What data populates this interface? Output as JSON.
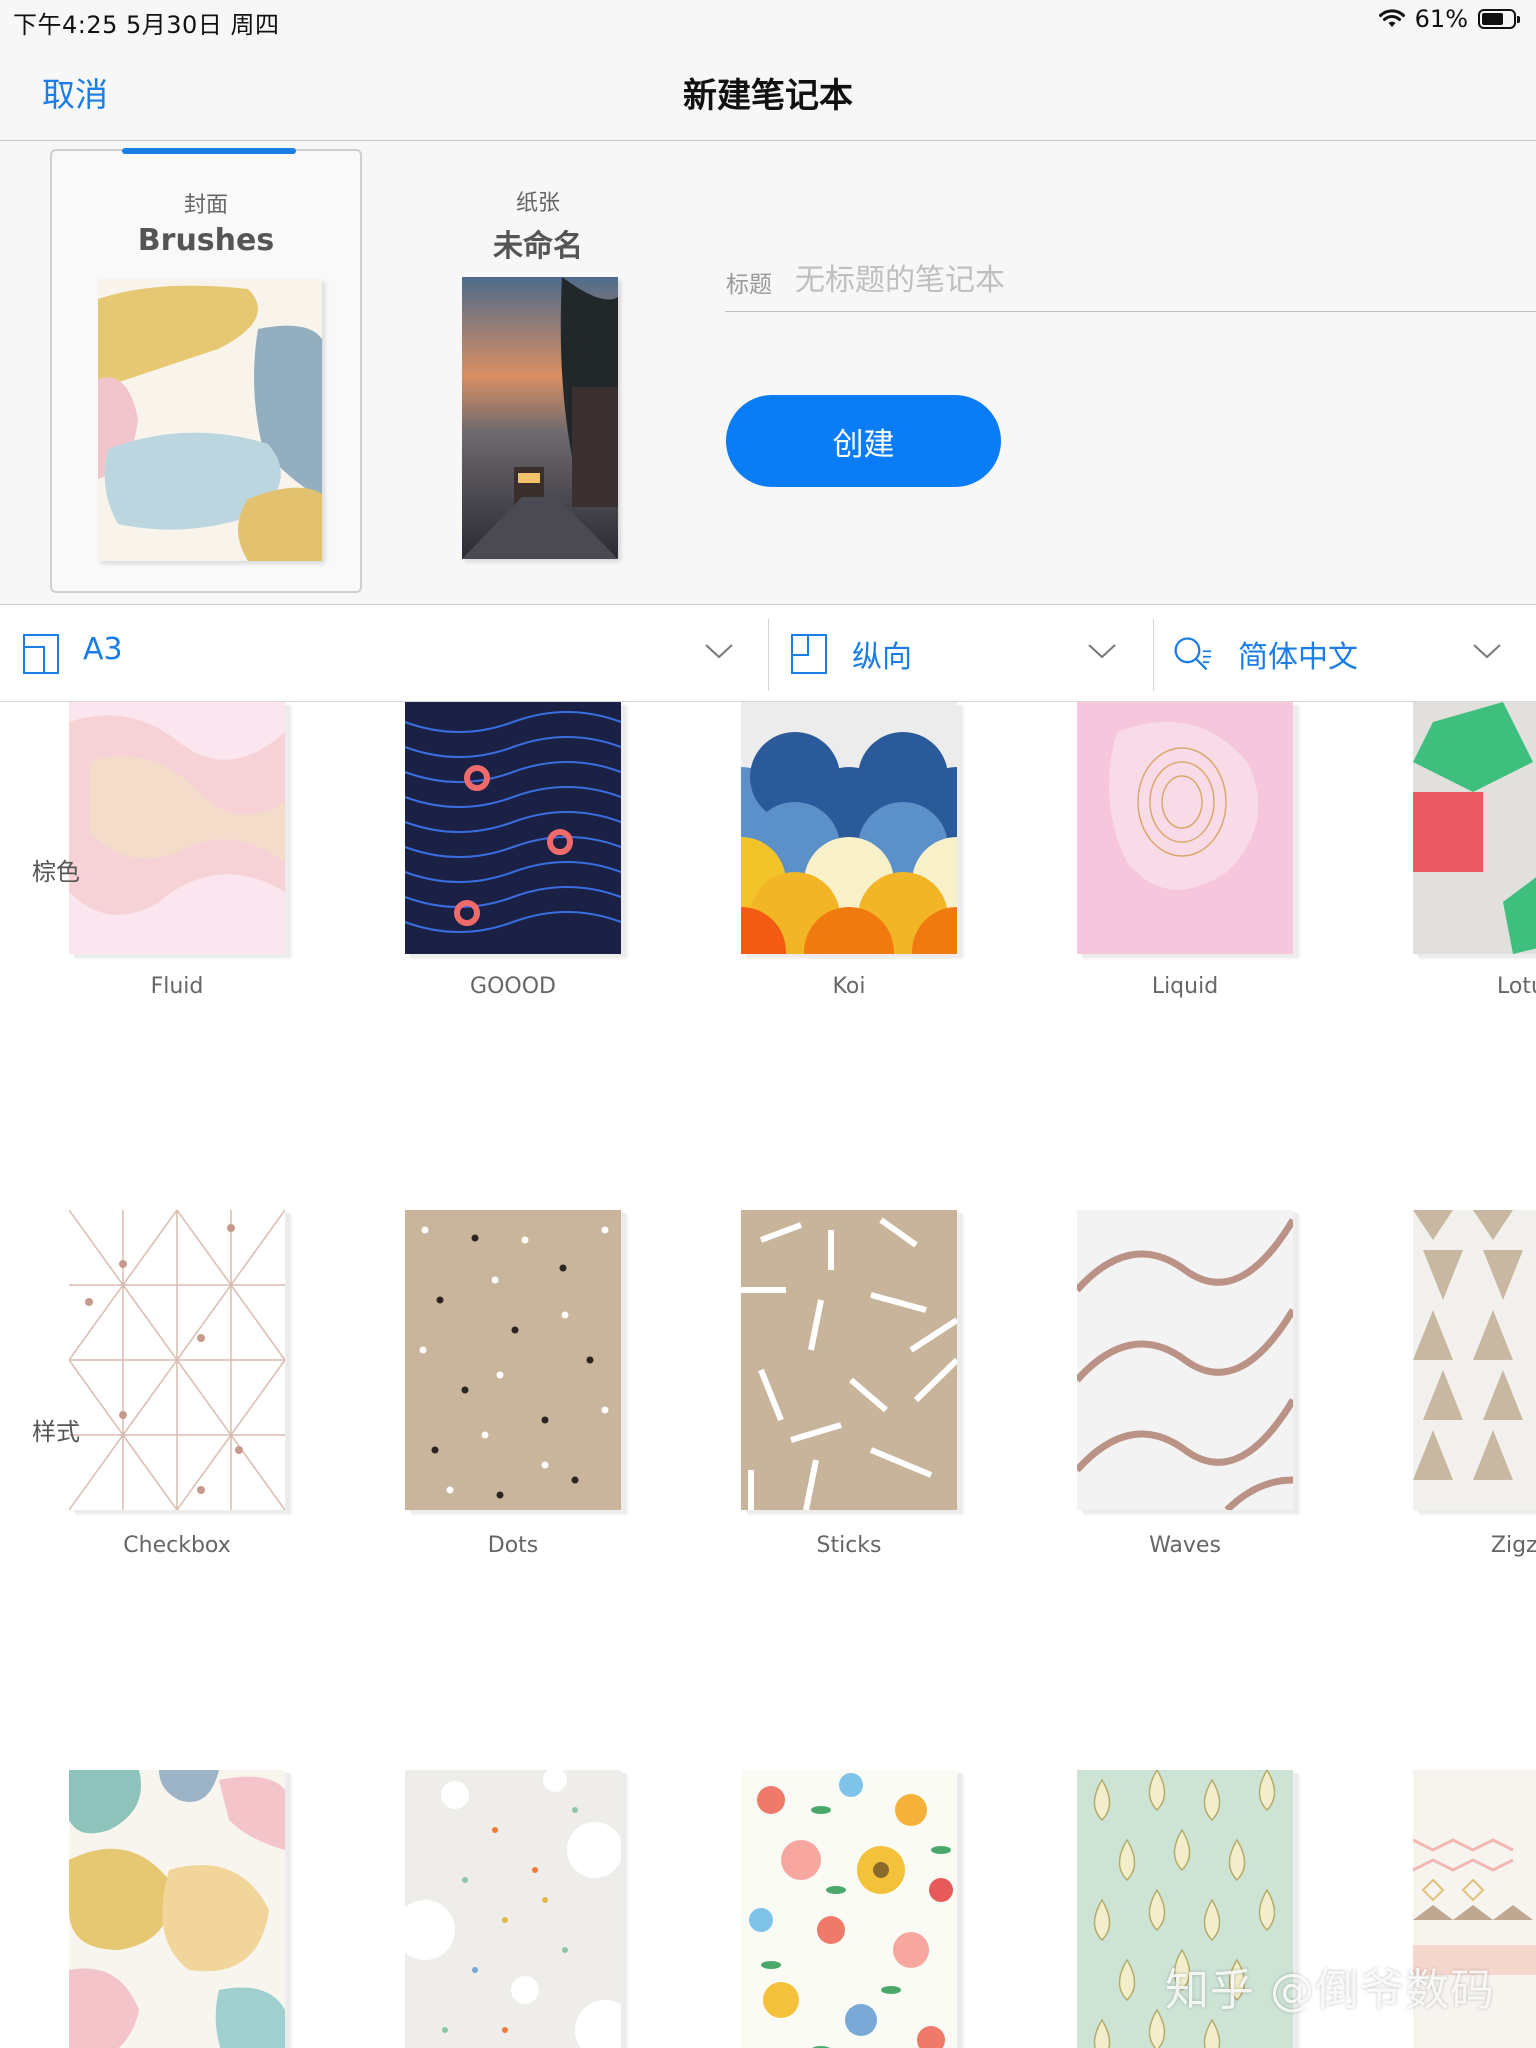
{
  "status_bar": {
    "time": "下午4:25   5月30日 周四",
    "battery_percent": "61%",
    "battery_level": 0.61
  },
  "nav": {
    "cancel_label": "取消",
    "title": "新建笔记本"
  },
  "cover": {
    "label": "封面",
    "name": "Brushes"
  },
  "paper": {
    "label": "纸张",
    "name": "未命名"
  },
  "title_field": {
    "label": "标题",
    "placeholder": "无标题的笔记本",
    "value": ""
  },
  "create_label": "创建",
  "options": {
    "size": "A3",
    "orientation": "纵向",
    "language": "简体中文"
  },
  "sections": [
    {
      "title": "",
      "items": [
        "Fluid",
        "GOOOD",
        "Koi",
        "Liquid",
        "Lotu"
      ]
    },
    {
      "title": "棕色",
      "items": [
        "Checkbox",
        "Dots",
        "Sticks",
        "Waves",
        "Zigza"
      ]
    },
    {
      "title": "样式",
      "items": [
        "",
        "",
        "",
        "",
        ""
      ]
    }
  ],
  "watermark": "知乎 @倒爷数码",
  "colors": {
    "accent": "#1a7ee6",
    "button": "#0a7cf5",
    "brown": "#c8b59b"
  }
}
